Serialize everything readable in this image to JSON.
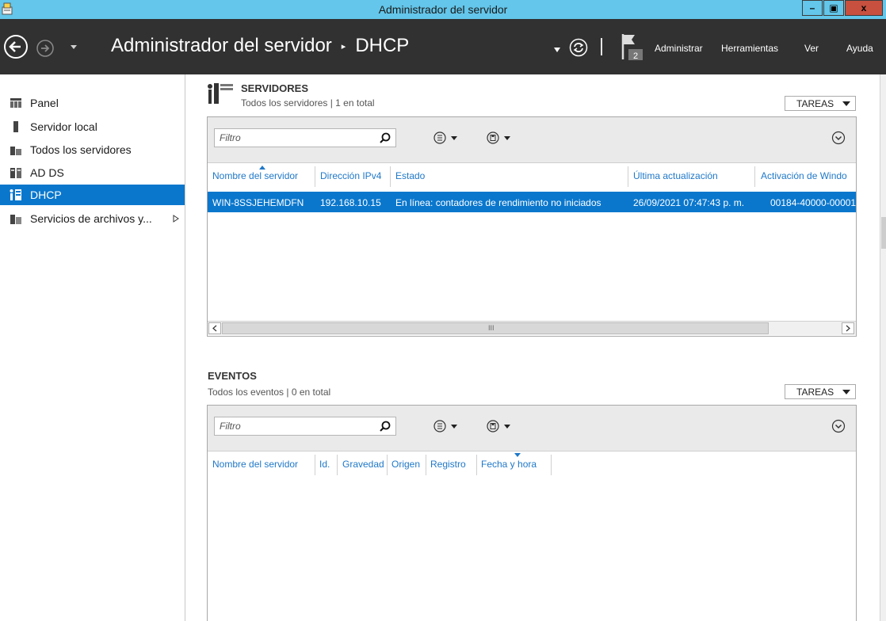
{
  "window": {
    "title": "Administrador del servidor",
    "minimize_label": "–",
    "maximize_label": "▣",
    "close_label": "x"
  },
  "header": {
    "breadcrumb_root": "Administrador del servidor",
    "breadcrumb_sep": "▸",
    "breadcrumb_current": "DHCP",
    "notification_count": "2",
    "menu": {
      "administrar": "Administrar",
      "herramientas": "Herramientas",
      "ver": "Ver",
      "ayuda": "Ayuda"
    }
  },
  "sidebar": {
    "items": [
      {
        "label": "Panel",
        "icon": "dashboard-icon"
      },
      {
        "label": "Servidor local",
        "icon": "local-server-icon"
      },
      {
        "label": "Todos los servidores",
        "icon": "all-servers-icon"
      },
      {
        "label": "AD DS",
        "icon": "ad-ds-icon"
      },
      {
        "label": "DHCP",
        "icon": "dhcp-icon",
        "active": true
      },
      {
        "label": "Servicios de archivos y...",
        "icon": "file-services-icon",
        "expandable": true
      }
    ]
  },
  "servers": {
    "title": "SERVIDORES",
    "subtitle": "Todos los servidores | 1 en total",
    "tasks": "TAREAS",
    "filter_placeholder": "Filtro",
    "columns": [
      "Nombre del servidor",
      "Dirección IPv4",
      "Estado",
      "Última actualización",
      "Activación de Windo"
    ],
    "rows": [
      [
        "WIN-8SSJEHEMDFN",
        "192.168.10.15",
        "En línea: contadores de rendimiento no iniciados",
        "26/09/2021 07:47:43 p. m.",
        "00184-40000-00001-"
      ]
    ],
    "scroll_thumb_label": "III"
  },
  "events": {
    "title": "EVENTOS",
    "subtitle": "Todos los eventos | 0 en total",
    "tasks": "TAREAS",
    "filter_placeholder": "Filtro",
    "columns": [
      "Nombre del servidor",
      "Id.",
      "Gravedad",
      "Origen",
      "Registro",
      "Fecha y hora"
    ]
  },
  "colors": {
    "titlebar": "#63c6ea",
    "header": "#313131",
    "accent": "#0a77cd",
    "column_header": "#1f78c8"
  }
}
